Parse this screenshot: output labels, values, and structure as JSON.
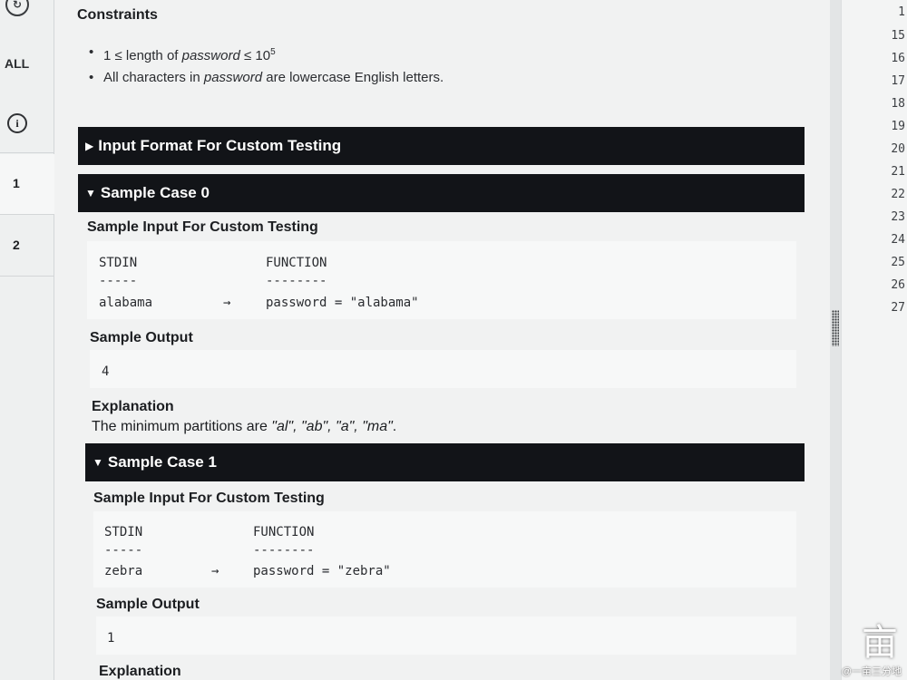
{
  "nav": {
    "all_label": "ALL",
    "info_icon": "info-icon",
    "questions": [
      {
        "label": "1"
      },
      {
        "label": "2"
      }
    ]
  },
  "constraints": {
    "title": "Constraints",
    "item1_prefix": "1 ≤ length of ",
    "item1_var": "password",
    "item1_mid": " ≤ 10",
    "item1_exp": "5",
    "item2_prefix": "All characters in ",
    "item2_var": "password",
    "item2_suffix": " are lowercase English letters."
  },
  "input_format_bar": "Input Format For Custom Testing",
  "sample0": {
    "bar": "Sample Case 0",
    "input_title": "Sample Input For Custom Testing",
    "col1_header": "STDIN",
    "col2_header": "FUNCTION",
    "col1_rule": "-----",
    "col2_rule": "--------",
    "stdin_value": "alabama",
    "arrow": "→",
    "function_value": "password = \"alabama\"",
    "output_title": "Sample Output",
    "output_value": "4",
    "explanation_title": "Explanation",
    "explanation_prefix": "The minimum partitions are ",
    "explanation_parts": "\"al\", \"ab\", \"a\", \"ma\"",
    "explanation_suffix": "."
  },
  "sample1": {
    "bar": "Sample Case 1",
    "input_title": "Sample Input For Custom Testing",
    "col1_header": "STDIN",
    "col2_header": "FUNCTION",
    "col1_rule": "-----",
    "col2_rule": "--------",
    "stdin_value": "zebra",
    "arrow": "→",
    "function_value": "password = \"zebra\"",
    "output_title": "Sample Output",
    "output_value": "1",
    "explanation_title": "Explanation"
  },
  "editor": {
    "line_numbers": [
      "1",
      "15",
      "16",
      "17",
      "18",
      "19",
      "20",
      "21",
      "22",
      "23",
      "24",
      "25",
      "26",
      "27"
    ]
  },
  "watermark": {
    "glyph": "亩",
    "text": "@一亩三分地"
  }
}
